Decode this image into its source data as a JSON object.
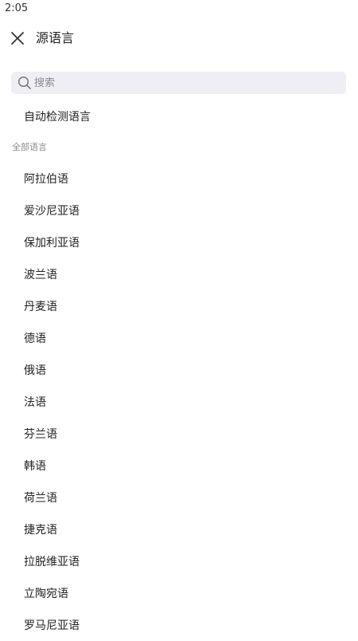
{
  "status_bar": {
    "time": "2:05"
  },
  "header": {
    "title": "源语言",
    "close_icon": "close-icon"
  },
  "search": {
    "placeholder": "搜索",
    "value": "",
    "icon": "search-icon"
  },
  "auto_detect_label": "自动检测语言",
  "section_label": "全部语言",
  "languages": [
    "阿拉伯语",
    "爱沙尼亚语",
    "保加利亚语",
    "波兰语",
    "丹麦语",
    "德语",
    "俄语",
    "法语",
    "芬兰语",
    "韩语",
    "荷兰语",
    "捷克语",
    "拉脱维亚语",
    "立陶宛语",
    "罗马尼亚语"
  ],
  "colors": {
    "search_bg": "#efeef4",
    "text": "#222222",
    "muted": "#8c8c8c"
  }
}
